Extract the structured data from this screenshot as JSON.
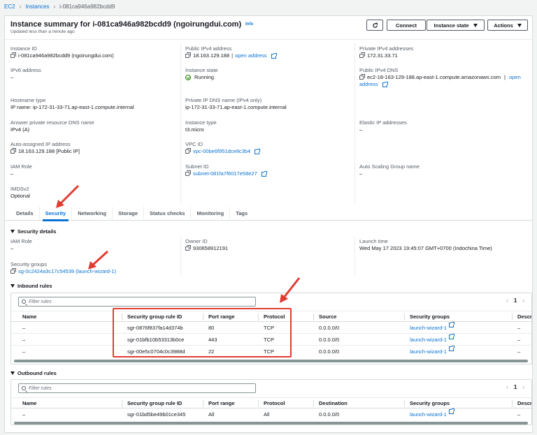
{
  "breadcrumb": [
    "EC2",
    "Instances",
    "i-081ca946a982bcdd9"
  ],
  "header": {
    "title": "Instance summary for i-081ca946a982bcdd9 (ngoirungdui.com)",
    "info": "Info",
    "subtitle": "Updated less than a minute ago",
    "refresh_icon": "refresh-icon",
    "connect": "Connect",
    "instance_state": "Instance state",
    "actions": "Actions"
  },
  "summary": {
    "instance_id_label": "Instance ID",
    "instance_id": "i-081ca946a982bcdd9 (ngoirungdui.com)",
    "ipv4_label": "Public IPv4 address",
    "ipv4": "18.163.129.188",
    "ipv4_link": "open address",
    "private_ipv4_label": "Private IPv4 addresses",
    "private_ipv4": "172.31.33.71",
    "ipv6_label": "IPv6 address",
    "ipv6": "–",
    "state_label": "Instance state",
    "state": "Running",
    "public_dns_label": "Public IPv4 DNS",
    "public_dns": "ec2-18-163-129-188.ap-east-1.compute.amazonaws.com",
    "public_dns_link_a": "open",
    "public_dns_link_b": "address",
    "hostname_label": "Hostname type",
    "hostname": "IP name: ip-172-31-33-71.ap-east-1.compute.internal",
    "private_dns_label": "Private IP DNS name (IPv4 only)",
    "private_dns": "ip-172-31-33-71.ap-east-1.compute.internal",
    "answer_dns_label": "Answer private resource DNS name",
    "answer_dns": "IPv4 (A)",
    "instance_type_label": "Instance type",
    "instance_type": "t3.micro",
    "elastic_ip_label": "Elastic IP addresses",
    "elastic_ip": "–",
    "auto_ip_label": "Auto-assigned IP address",
    "auto_ip": "18.163.129.188 [Public IP]",
    "vpc_label": "VPC ID",
    "vpc": "vpc-00be6f951dce8c3b4",
    "iam_label": "IAM Role",
    "iam": "–",
    "subnet_label": "Subnet ID",
    "subnet": "subnet-081fa7f6017e58e27",
    "asg_label": "Auto Scaling Group name",
    "asg": "–",
    "imds_label": "IMDSv2",
    "imds": "Optional"
  },
  "tabs": [
    "Details",
    "Security",
    "Networking",
    "Storage",
    "Status checks",
    "Monitoring",
    "Tags"
  ],
  "security": {
    "section": "Security details",
    "iam_label": "IAM Role",
    "iam": "–",
    "owner_label": "Owner ID",
    "owner": "930658912191",
    "launch_label": "Launch time",
    "launch": "Wed May 17 2023 19:45:07 GMT+0700 (Indochina Time)",
    "sg_label": "Security groups",
    "sg": "sg-0c2424a3c17c54539 (launch-wizard-1)"
  },
  "inbound": {
    "title": "Inbound rules",
    "filter_placeholder": "Filter rules",
    "page": "1",
    "columns": [
      "Name",
      "Security group rule ID",
      "Port range",
      "Protocol",
      "Source",
      "Security groups",
      "Descri"
    ],
    "rows": [
      [
        "–",
        "sgr-0876f837fa14d374b",
        "80",
        "TCP",
        "0.0.0.0/0",
        "launch-wizard-1",
        "–"
      ],
      [
        "–",
        "sgr-01bfb10b53313b0ce",
        "443",
        "TCP",
        "0.0.0.0/0",
        "launch-wizard-1",
        "–"
      ],
      [
        "–",
        "sgr-00e5c0704c0c3988d",
        "22",
        "TCP",
        "0.0.0.0/0",
        "launch-wizard-1",
        "–"
      ]
    ]
  },
  "outbound": {
    "title": "Outbound rules",
    "filter_placeholder": "Filter rules",
    "page": "1",
    "columns": [
      "Name",
      "Security group rule ID",
      "Port range",
      "Protocol",
      "Destination",
      "Security groups",
      "Descri"
    ],
    "rows": [
      [
        "–",
        "sgr-01bd5be49b01ce345",
        "All",
        "All",
        "0.0.0.0/0",
        "launch-wizard-1",
        "–"
      ]
    ]
  },
  "colors": {
    "link": "#0972d3",
    "running": "#1d8102",
    "annotation": "#e03c31"
  }
}
